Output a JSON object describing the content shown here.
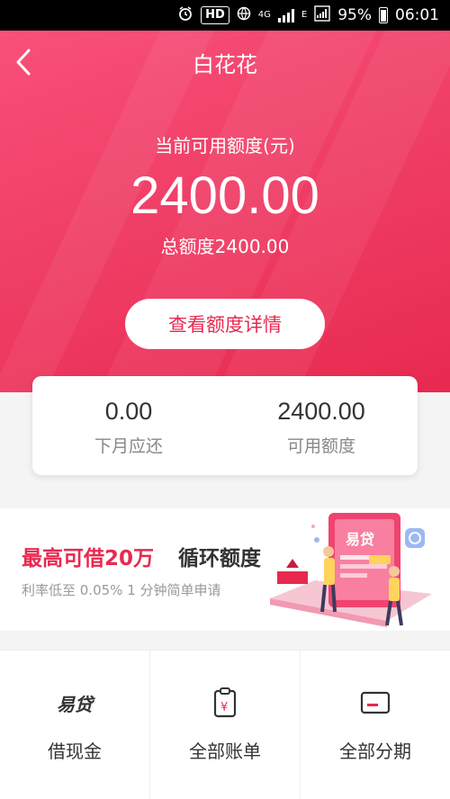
{
  "status_bar": {
    "hd": "HD",
    "net": "4G",
    "e_label": "E",
    "battery": "95%",
    "time": "06:01"
  },
  "header": {
    "title": "白花花",
    "back_icon": "chevron-left-icon"
  },
  "credit": {
    "available_label": "当前可用额度(元)",
    "available_amount": "2400.00",
    "total_text": "总额度2400.00",
    "detail_button": "查看额度详情"
  },
  "summary": {
    "next_month_value": "0.00",
    "next_month_label": "下月应还",
    "available_value": "2400.00",
    "available_label": "可用额度"
  },
  "promo": {
    "headline": "最高可借20万",
    "cycle": "循环额度",
    "subtext": "利率低至 0.05%  1 分钟简单申请",
    "illustration_logo": "易贷"
  },
  "grid": {
    "items": [
      {
        "label": "借现金",
        "logo": "易贷",
        "icon": "yidai-logo"
      },
      {
        "label": "全部账单",
        "icon": "bill-clipboard-icon"
      },
      {
        "label": "全部分期",
        "icon": "card-icon"
      }
    ]
  },
  "colors": {
    "accent": "#e8294f",
    "hero_top": "#f8507a"
  }
}
